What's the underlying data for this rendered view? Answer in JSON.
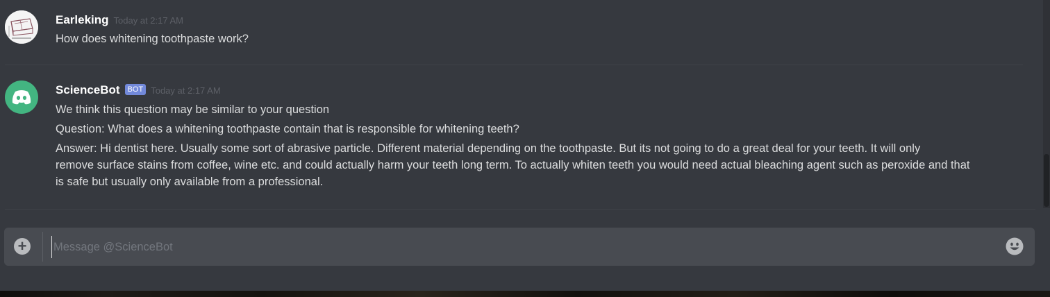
{
  "messages": [
    {
      "username": "Earleking",
      "timestamp": "Today at 2:17 AM",
      "is_bot": false,
      "avatar": "user-avatar-sketch",
      "lines": [
        "How does whitening toothpaste work?"
      ]
    },
    {
      "username": "ScienceBot",
      "bot_tag": "BOT",
      "timestamp": "Today at 2:17 AM",
      "is_bot": true,
      "avatar": "discord-logo-icon",
      "lines": [
        "We think this question may be similar to your question",
        "Question: What does a whitening toothpaste contain that is responsible for whitening teeth?",
        "Answer: Hi dentist here. Usually some sort of abrasive particle. Different material depending on the toothpaste. But its not going to do a great deal for your teeth. It will only",
        "remove surface stains from coffee, wine etc. and could actually harm your teeth long term. To actually whiten teeth you would need actual bleaching agent such as peroxide and that",
        "is safe but usually only available from a professional."
      ]
    }
  ],
  "composer": {
    "placeholder": "Message @ScienceBot",
    "value": "",
    "attach_icon": "plus-circle-icon",
    "emoji_icon": "emoji-icon"
  },
  "colors": {
    "background": "#36393f",
    "input_background": "#484b51",
    "bot_avatar": "#43b581",
    "bot_tag": "#7289da",
    "text": "#dcddde",
    "username": "#ffffff",
    "timestamp": "#5d6067"
  }
}
